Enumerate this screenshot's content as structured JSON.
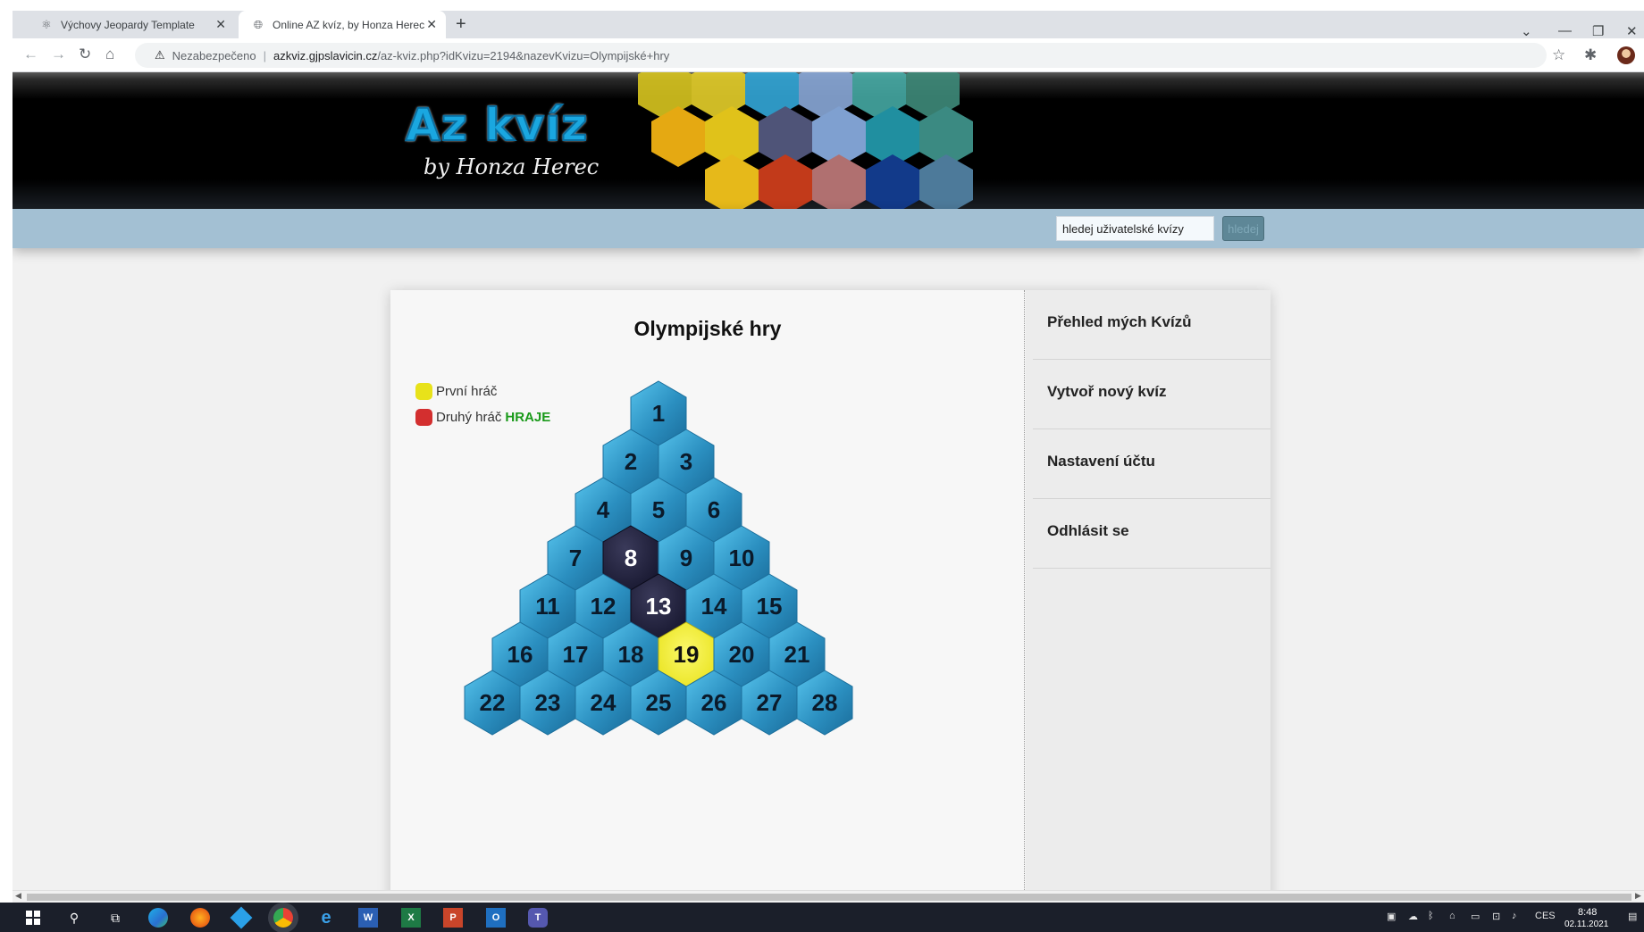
{
  "browser": {
    "tabs": [
      {
        "title": "Výchovy Jeopardy Template"
      },
      {
        "title": "Online AZ kvíz, by Honza Herec"
      }
    ],
    "security_label": "Nezabezpečeno",
    "url_host": "azkviz.gjpslavicin.cz",
    "url_path": "/az-kviz.php?idKvizu=2194&nazevKvizu=Olympijské+hry"
  },
  "site": {
    "logo_title": "Az kvíz",
    "logo_subtitle": "by Honza Herec",
    "search_placeholder": "hledej uživatelské kvízy",
    "search_button": "hledej"
  },
  "quiz": {
    "title": "Olympijské hry",
    "players": [
      {
        "name": "První hráč",
        "color": "#e8e21a"
      },
      {
        "name": "Druhý hráč",
        "color": "#d32f2f",
        "status": "HRAJE",
        "status_color": "#1a9a1a"
      }
    ],
    "tiles": [
      1,
      2,
      3,
      4,
      5,
      6,
      7,
      8,
      9,
      10,
      11,
      12,
      13,
      14,
      15,
      16,
      17,
      18,
      19,
      20,
      21,
      22,
      23,
      24,
      25,
      26,
      27,
      28
    ],
    "tile_states": {
      "8": "dark",
      "13": "dark",
      "19": "player1"
    },
    "colors": {
      "default": "#2b8fc0",
      "dark": "#16162e",
      "player1": "#e8e21a"
    }
  },
  "sidebar": {
    "items": [
      {
        "label": "Přehled mých Kvízů"
      },
      {
        "label": "Vytvoř nový kvíz"
      },
      {
        "label": "Nastavení účtu"
      },
      {
        "label": "Odhlásit se"
      }
    ]
  },
  "taskbar": {
    "language": "CES",
    "time": "8:48",
    "date": "02.11.2021"
  }
}
